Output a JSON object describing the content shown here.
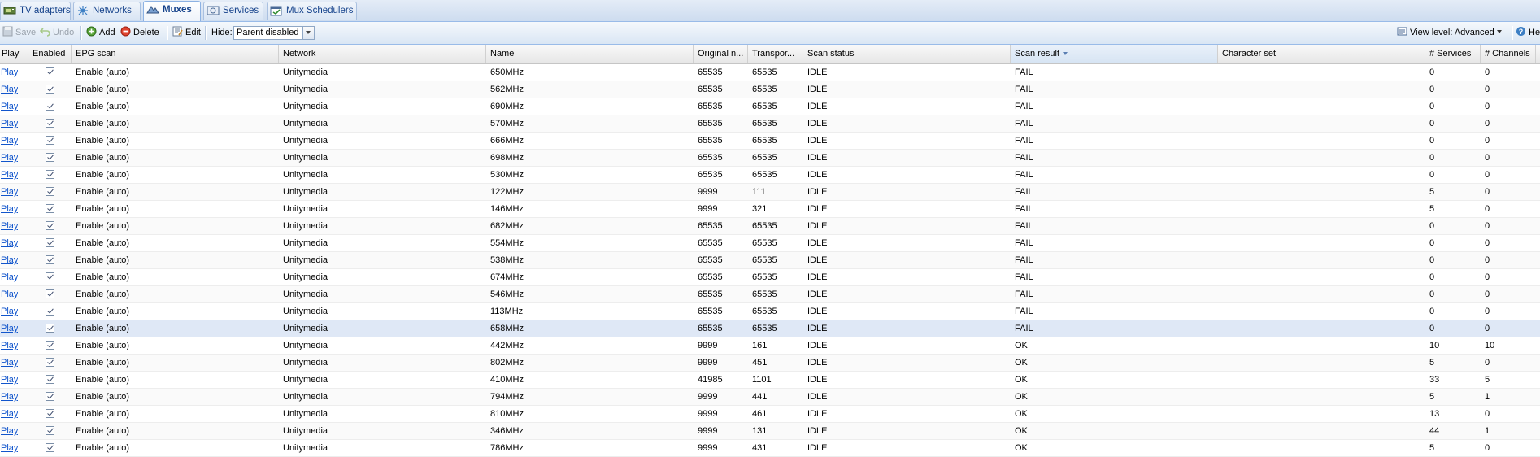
{
  "tabs": [
    {
      "label": "TV adapters",
      "icon": "tv-adapter-icon"
    },
    {
      "label": "Networks",
      "icon": "network-icon"
    },
    {
      "label": "Muxes",
      "icon": "mux-icon"
    },
    {
      "label": "Services",
      "icon": "services-icon"
    },
    {
      "label": "Mux Schedulers",
      "icon": "mux-scheduler-icon"
    }
  ],
  "toolbar": {
    "save_label": "Save",
    "undo_label": "Undo",
    "add_label": "Add",
    "delete_label": "Delete",
    "edit_label": "Edit",
    "hide_label": "Hide:",
    "hide_value": "Parent disabled",
    "view_level_label": "View level: Advanced",
    "help_label": "He"
  },
  "grid": {
    "sorted_column": "Scan result",
    "columns": [
      "Play",
      "Enabled",
      "EPG scan",
      "Network",
      "Name",
      "Original n...",
      "Transpor...",
      "Scan status",
      "Scan result",
      "Character set",
      "# Services",
      "# Channels"
    ],
    "rows": [
      {
        "play": "Play",
        "enabled": true,
        "epg": "Enable (auto)",
        "network": "Unitymedia",
        "name": "650MHz",
        "onid": "65535",
        "tsid": "65535",
        "status": "IDLE",
        "result": "FAIL",
        "charset": "",
        "services": "0",
        "channels": "0"
      },
      {
        "play": "Play",
        "enabled": true,
        "epg": "Enable (auto)",
        "network": "Unitymedia",
        "name": "562MHz",
        "onid": "65535",
        "tsid": "65535",
        "status": "IDLE",
        "result": "FAIL",
        "charset": "",
        "services": "0",
        "channels": "0"
      },
      {
        "play": "Play",
        "enabled": true,
        "epg": "Enable (auto)",
        "network": "Unitymedia",
        "name": "690MHz",
        "onid": "65535",
        "tsid": "65535",
        "status": "IDLE",
        "result": "FAIL",
        "charset": "",
        "services": "0",
        "channels": "0"
      },
      {
        "play": "Play",
        "enabled": true,
        "epg": "Enable (auto)",
        "network": "Unitymedia",
        "name": "570MHz",
        "onid": "65535",
        "tsid": "65535",
        "status": "IDLE",
        "result": "FAIL",
        "charset": "",
        "services": "0",
        "channels": "0"
      },
      {
        "play": "Play",
        "enabled": true,
        "epg": "Enable (auto)",
        "network": "Unitymedia",
        "name": "666MHz",
        "onid": "65535",
        "tsid": "65535",
        "status": "IDLE",
        "result": "FAIL",
        "charset": "",
        "services": "0",
        "channels": "0"
      },
      {
        "play": "Play",
        "enabled": true,
        "epg": "Enable (auto)",
        "network": "Unitymedia",
        "name": "698MHz",
        "onid": "65535",
        "tsid": "65535",
        "status": "IDLE",
        "result": "FAIL",
        "charset": "",
        "services": "0",
        "channels": "0"
      },
      {
        "play": "Play",
        "enabled": true,
        "epg": "Enable (auto)",
        "network": "Unitymedia",
        "name": "530MHz",
        "onid": "65535",
        "tsid": "65535",
        "status": "IDLE",
        "result": "FAIL",
        "charset": "",
        "services": "0",
        "channels": "0"
      },
      {
        "play": "Play",
        "enabled": true,
        "epg": "Enable (auto)",
        "network": "Unitymedia",
        "name": "122MHz",
        "onid": "9999",
        "tsid": "111",
        "status": "IDLE",
        "result": "FAIL",
        "charset": "",
        "services": "5",
        "channels": "0"
      },
      {
        "play": "Play",
        "enabled": true,
        "epg": "Enable (auto)",
        "network": "Unitymedia",
        "name": "146MHz",
        "onid": "9999",
        "tsid": "321",
        "status": "IDLE",
        "result": "FAIL",
        "charset": "",
        "services": "5",
        "channels": "0"
      },
      {
        "play": "Play",
        "enabled": true,
        "epg": "Enable (auto)",
        "network": "Unitymedia",
        "name": "682MHz",
        "onid": "65535",
        "tsid": "65535",
        "status": "IDLE",
        "result": "FAIL",
        "charset": "",
        "services": "0",
        "channels": "0"
      },
      {
        "play": "Play",
        "enabled": true,
        "epg": "Enable (auto)",
        "network": "Unitymedia",
        "name": "554MHz",
        "onid": "65535",
        "tsid": "65535",
        "status": "IDLE",
        "result": "FAIL",
        "charset": "",
        "services": "0",
        "channels": "0"
      },
      {
        "play": "Play",
        "enabled": true,
        "epg": "Enable (auto)",
        "network": "Unitymedia",
        "name": "538MHz",
        "onid": "65535",
        "tsid": "65535",
        "status": "IDLE",
        "result": "FAIL",
        "charset": "",
        "services": "0",
        "channels": "0"
      },
      {
        "play": "Play",
        "enabled": true,
        "epg": "Enable (auto)",
        "network": "Unitymedia",
        "name": "674MHz",
        "onid": "65535",
        "tsid": "65535",
        "status": "IDLE",
        "result": "FAIL",
        "charset": "",
        "services": "0",
        "channels": "0"
      },
      {
        "play": "Play",
        "enabled": true,
        "epg": "Enable (auto)",
        "network": "Unitymedia",
        "name": "546MHz",
        "onid": "65535",
        "tsid": "65535",
        "status": "IDLE",
        "result": "FAIL",
        "charset": "",
        "services": "0",
        "channels": "0"
      },
      {
        "play": "Play",
        "enabled": true,
        "epg": "Enable (auto)",
        "network": "Unitymedia",
        "name": "113MHz",
        "onid": "65535",
        "tsid": "65535",
        "status": "IDLE",
        "result": "FAIL",
        "charset": "",
        "services": "0",
        "channels": "0"
      },
      {
        "play": "Play",
        "enabled": true,
        "epg": "Enable (auto)",
        "network": "Unitymedia",
        "name": "658MHz",
        "onid": "65535",
        "tsid": "65535",
        "status": "IDLE",
        "result": "FAIL",
        "charset": "",
        "services": "0",
        "channels": "0",
        "selected": true
      },
      {
        "play": "Play",
        "enabled": true,
        "epg": "Enable (auto)",
        "network": "Unitymedia",
        "name": "442MHz",
        "onid": "9999",
        "tsid": "161",
        "status": "IDLE",
        "result": "OK",
        "charset": "",
        "services": "10",
        "channels": "10"
      },
      {
        "play": "Play",
        "enabled": true,
        "epg": "Enable (auto)",
        "network": "Unitymedia",
        "name": "802MHz",
        "onid": "9999",
        "tsid": "451",
        "status": "IDLE",
        "result": "OK",
        "charset": "",
        "services": "5",
        "channels": "0"
      },
      {
        "play": "Play",
        "enabled": true,
        "epg": "Enable (auto)",
        "network": "Unitymedia",
        "name": "410MHz",
        "onid": "41985",
        "tsid": "1101",
        "status": "IDLE",
        "result": "OK",
        "charset": "",
        "services": "33",
        "channels": "5"
      },
      {
        "play": "Play",
        "enabled": true,
        "epg": "Enable (auto)",
        "network": "Unitymedia",
        "name": "794MHz",
        "onid": "9999",
        "tsid": "441",
        "status": "IDLE",
        "result": "OK",
        "charset": "",
        "services": "5",
        "channels": "1"
      },
      {
        "play": "Play",
        "enabled": true,
        "epg": "Enable (auto)",
        "network": "Unitymedia",
        "name": "810MHz",
        "onid": "9999",
        "tsid": "461",
        "status": "IDLE",
        "result": "OK",
        "charset": "",
        "services": "13",
        "channels": "0"
      },
      {
        "play": "Play",
        "enabled": true,
        "epg": "Enable (auto)",
        "network": "Unitymedia",
        "name": "346MHz",
        "onid": "9999",
        "tsid": "131",
        "status": "IDLE",
        "result": "OK",
        "charset": "",
        "services": "44",
        "channels": "1"
      },
      {
        "play": "Play",
        "enabled": true,
        "epg": "Enable (auto)",
        "network": "Unitymedia",
        "name": "786MHz",
        "onid": "9999",
        "tsid": "431",
        "status": "IDLE",
        "result": "OK",
        "charset": "",
        "services": "5",
        "channels": "0"
      }
    ]
  },
  "colors": {
    "link": "#1155cc",
    "selected_row": "#dfe8f6",
    "tab_text": "#15428b"
  }
}
